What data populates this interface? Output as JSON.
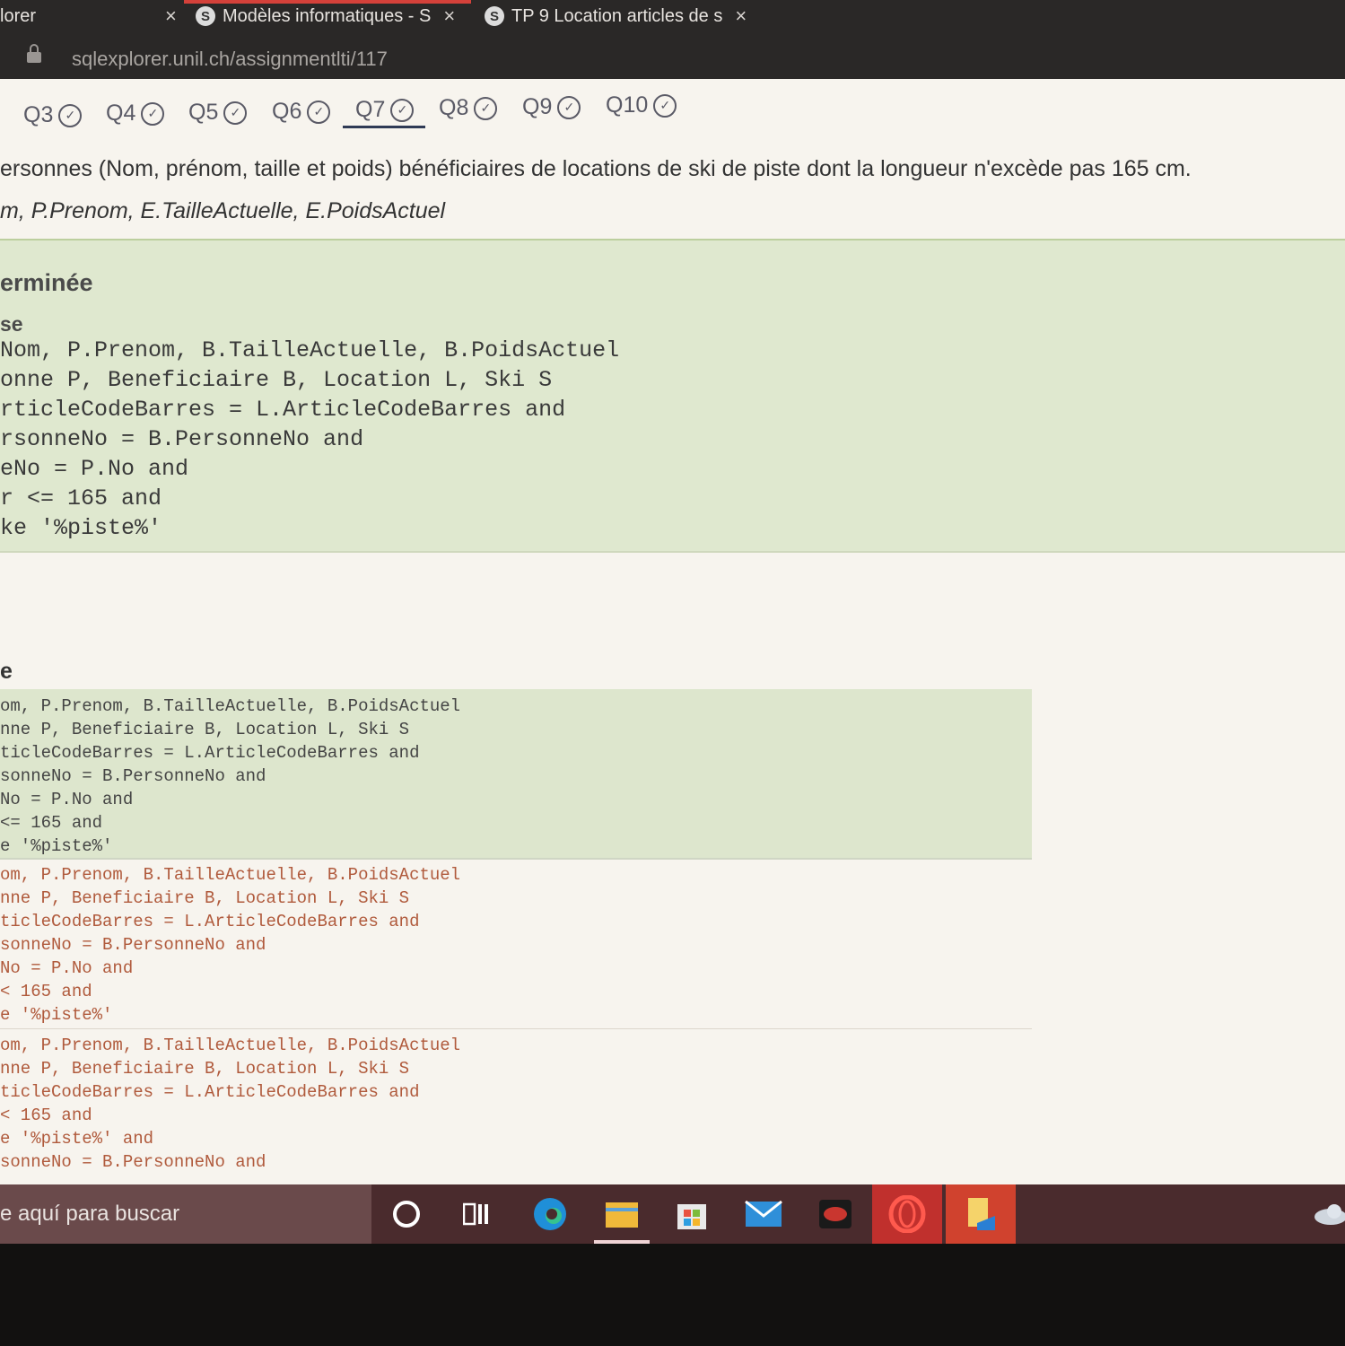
{
  "browser": {
    "tabs": [
      {
        "label": "lorer",
        "close": "×"
      },
      {
        "label": "Modèles informatiques - S",
        "close": "×"
      },
      {
        "label": "TP 9 Location articles de s",
        "close": "×"
      }
    ],
    "url_domain": "sqlexplorer.unil.ch",
    "url_path": "/assignmentlti/117"
  },
  "question_nav": {
    "items": [
      "Q3",
      "Q4",
      "Q5",
      "Q6",
      "Q7",
      "Q8",
      "Q9",
      "Q10"
    ],
    "active": "Q7",
    "check_glyph": "✓"
  },
  "question": {
    "text": "ersonnes (Nom, prénom, taille et poids) bénéficiaires de locations de ski de piste dont la longueur n'excède pas 165 cm.",
    "expected_columns": "m, P.Prenom, E.TailleActuelle, E.PoidsActuel"
  },
  "result": {
    "status": "erminée",
    "subtitle": "se",
    "query_lines": [
      "Nom, P.Prenom, B.TailleActuelle, B.PoidsActuel",
      "onne P, Beneficiaire B, Location L, Ski S",
      "rticleCodeBarres = L.ArticleCodeBarres and",
      "rsonneNo = B.PersonneNo and",
      "eNo = P.No and",
      "r <= 165 and",
      "ke '%piste%'"
    ]
  },
  "history": {
    "label": "e",
    "entries": [
      {
        "lines": [
          "om, P.Prenom, B.TailleActuelle, B.PoidsActuel",
          "nne P, Beneficiaire B, Location L, Ski S",
          "ticleCodeBarres = L.ArticleCodeBarres and",
          "sonneNo = B.PersonneNo and",
          "No = P.No and",
          " <= 165 and",
          "e '%piste%'"
        ]
      },
      {
        "lines": [
          "om, P.Prenom, B.TailleActuelle, B.PoidsActuel",
          "nne P, Beneficiaire B, Location L, Ski S",
          "ticleCodeBarres = L.ArticleCodeBarres and",
          "sonneNo = B.PersonneNo and",
          "No = P.No and",
          " < 165 and",
          "e '%piste%'"
        ]
      },
      {
        "lines": [
          "om, P.Prenom, B.TailleActuelle, B.PoidsActuel",
          "nne P, Beneficiaire B, Location L, Ski S",
          "ticleCodeBarres = L.ArticleCodeBarres and",
          " < 165 and",
          "e '%piste%' and",
          "sonneNo = B.PersonneNo and"
        ]
      }
    ]
  },
  "taskbar": {
    "search_placeholder": "e aquí para buscar"
  },
  "colors": {
    "accent_tab": "#d4413a",
    "result_bg": "#dfe8cf",
    "error_text": "#b05a3c",
    "taskbar_bg": "#4a2b2d"
  }
}
